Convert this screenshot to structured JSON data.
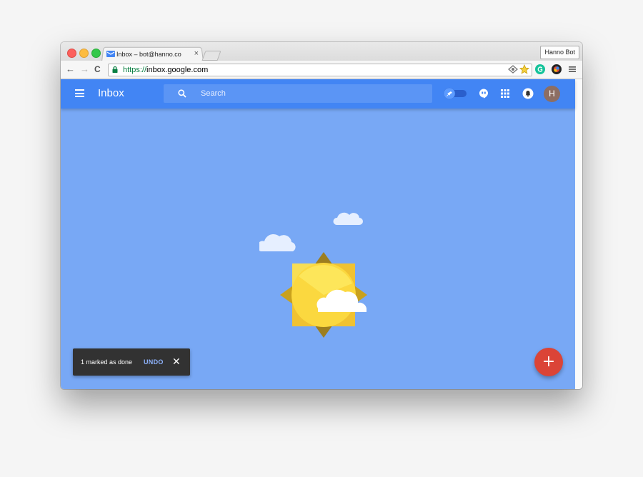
{
  "browser": {
    "tab": {
      "title": "Inbox – bot@hanno.co",
      "close_glyph": "×",
      "favicon": "inbox-favicon-icon"
    },
    "profile_name": "Hanno Bot",
    "nav": {
      "back": "←",
      "forward": "→",
      "reload": "C"
    },
    "address": {
      "scheme": "https://",
      "host": "inbox.google.com"
    },
    "extensions": [
      "eye-extension-icon",
      "star-icon",
      "grammarly-icon",
      "colorpicker-extension-icon",
      "chrome-menu-icon"
    ]
  },
  "app": {
    "title": "Inbox",
    "search": {
      "placeholder": "Search"
    },
    "avatar_initial": "H",
    "colors": {
      "appbar": "#4285f4",
      "background": "#78a8f5",
      "fab": "#db4437",
      "toast": "#323232"
    }
  },
  "toast": {
    "message": "1 marked as done",
    "action": "UNDO",
    "close": "✕"
  },
  "fab": {
    "label": "+"
  }
}
